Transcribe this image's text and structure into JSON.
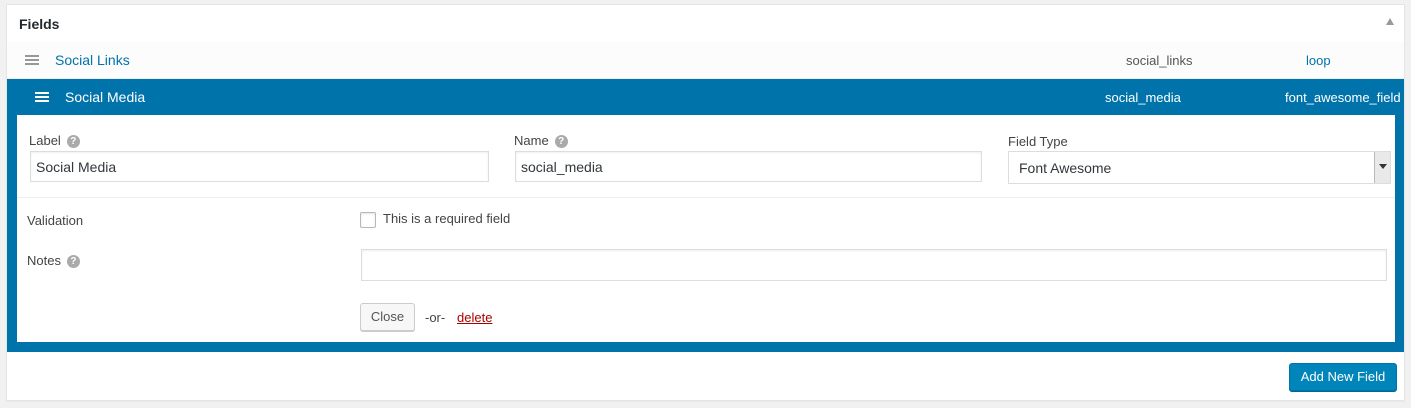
{
  "panel": {
    "title": "Fields"
  },
  "fields": [
    {
      "label": "Social Links",
      "name": "social_links",
      "type": "loop"
    },
    {
      "label": "Social Media",
      "name": "social_media",
      "type": "font_awesome_field"
    }
  ],
  "editor": {
    "label_title": "Label",
    "label_value": "Social Media",
    "name_title": "Name",
    "name_value": "social_media",
    "type_title": "Field Type",
    "type_value": "Font Awesome",
    "validation_title": "Validation",
    "required_label": "This is a required field",
    "required_checked": false,
    "notes_title": "Notes",
    "notes_value": "",
    "close_label": "Close",
    "or_text": "-or-",
    "delete_label": "delete",
    "help_glyph": "?"
  },
  "footer": {
    "add_label": "Add New Field"
  },
  "colors": {
    "accent": "#0073aa",
    "button_primary": "#0085ba",
    "delete": "#aa0000"
  }
}
